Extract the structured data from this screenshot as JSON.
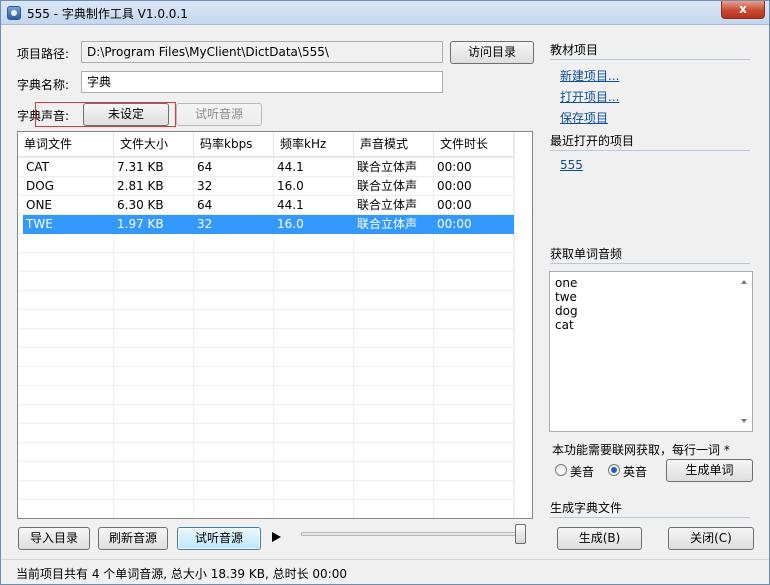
{
  "window": {
    "title": "555 - 字典制作工具 V1.0.0.1",
    "close_label": "x"
  },
  "form": {
    "path_label": "项目路径:",
    "path_value": "D:\\Program Files\\MyClient\\DictData\\555\\",
    "visit_button": "访问目录",
    "name_label": "字典名称:",
    "name_value": "字典",
    "voice_label": "字典声音:",
    "voice_button": "未设定",
    "preview_button": "试听音源"
  },
  "table": {
    "columns": [
      "单词文件",
      "文件大小",
      "码率kbps",
      "频率kHz",
      "声音模式",
      "文件时长"
    ],
    "rows": [
      [
        "CAT",
        "7.31 KB",
        "64",
        "44.1",
        "联合立体声",
        "00:00"
      ],
      [
        "DOG",
        "2.81 KB",
        "32",
        "16.0",
        "联合立体声",
        "00:00"
      ],
      [
        "ONE",
        "6.30 KB",
        "64",
        "44.1",
        "联合立体声",
        "00:00"
      ],
      [
        "TWE",
        "1.97 KB",
        "32",
        "16.0",
        "联合立体声",
        "00:00"
      ]
    ],
    "selected_row": 3
  },
  "bottom": {
    "import_button": "导入目录",
    "refresh_button": "刷新音源",
    "preview_button": "试听音源",
    "play_icon": "play-icon"
  },
  "sidebar": {
    "textbook_title": "教材项目",
    "links": [
      "新建项目...",
      "打开项目...",
      "保存项目"
    ],
    "recent_title": "最近打开的项目",
    "recent_items": [
      "555"
    ],
    "fetch_title": "获取单词音频",
    "words": [
      "one",
      "twe",
      "dog",
      "cat"
    ],
    "note": "本功能需要联网获取，每行一词 *",
    "radio_us": "美音",
    "radio_uk": "英音",
    "selected_radio": "英音",
    "generate_words_button": "生成单词",
    "build_title": "生成字典文件",
    "build_button": "生成(B)",
    "close_button": "关闭(C)"
  },
  "status": {
    "text": "当前项目共有 4 个单词音源, 总大小 18.39 KB, 总时长 00:00"
  }
}
